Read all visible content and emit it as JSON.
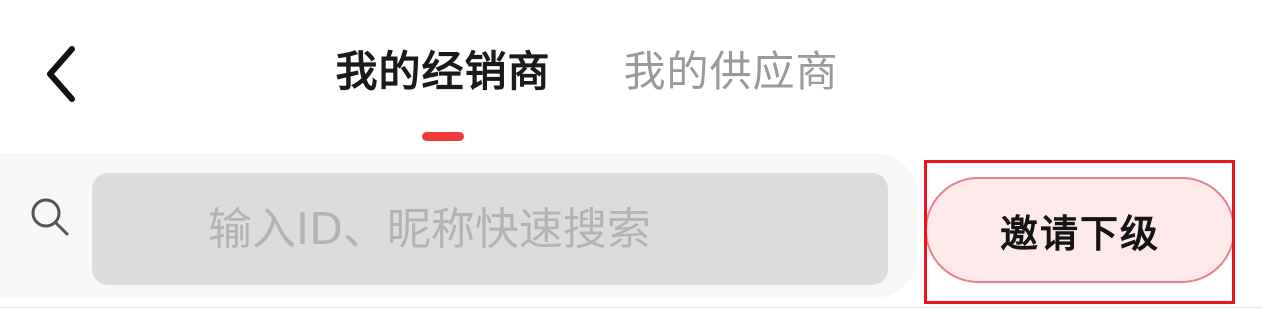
{
  "header": {
    "back_icon": "chevron-left-icon",
    "tabs": [
      {
        "label": "我的经销商",
        "active": true
      },
      {
        "label": "我的供应商",
        "active": false
      }
    ],
    "indicator_color": "#ef3b3b"
  },
  "search": {
    "icon": "search-icon",
    "placeholder": "输入ID、昵称快速搜索",
    "value": ""
  },
  "invite": {
    "label": "邀请下级",
    "highlighted": true,
    "highlight_color": "#e8141a"
  }
}
